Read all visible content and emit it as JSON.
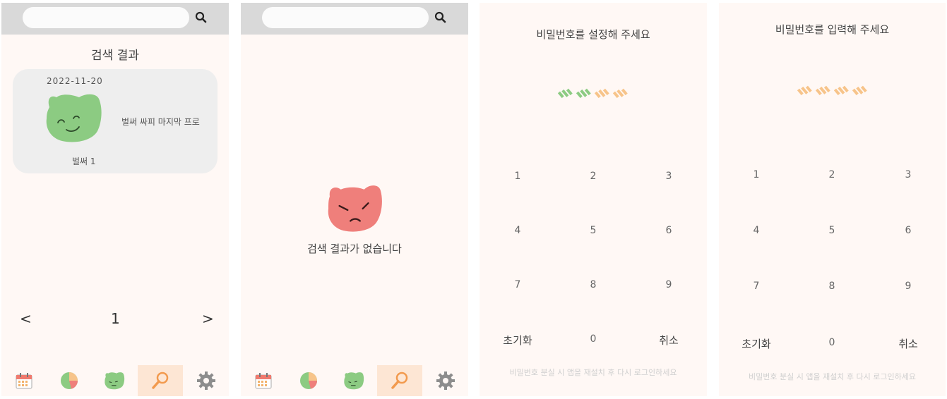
{
  "screen1": {
    "search": {
      "value": "",
      "placeholder": ""
    },
    "title": "검색 결과",
    "result": {
      "date": "2022-11-20",
      "snippet": "벌써 싸피 마지막 프로",
      "category": "벌써 1"
    },
    "pager": {
      "prev": "<",
      "page": "1",
      "next": ">"
    }
  },
  "screen2": {
    "search": {
      "value": "",
      "placeholder": ""
    },
    "empty_message": "검색 결과가 없습니다"
  },
  "screen3": {
    "title": "비밀번호를 설정해 주세요",
    "keys": [
      "1",
      "2",
      "3",
      "4",
      "5",
      "6",
      "7",
      "8",
      "9",
      "초기화",
      "0",
      "취소"
    ],
    "hint": "비밀번호 분실 시 앱을 재설치 후 다시 로그인하세요",
    "dots": [
      "filled",
      "filled",
      "empty",
      "empty"
    ]
  },
  "screen4": {
    "title": "비밀번호를 입력해 주세요",
    "keys": [
      "1",
      "2",
      "3",
      "4",
      "5",
      "6",
      "7",
      "8",
      "9",
      "초기화",
      "0",
      "취소"
    ],
    "hint": "비밀번호 분실 시 앱을 재설치 후 다시 로그인하세요",
    "dots": [
      "empty",
      "empty",
      "empty",
      "empty"
    ]
  },
  "nav_items": [
    {
      "icon": "calendar-icon"
    },
    {
      "icon": "pie-chart-icon"
    },
    {
      "icon": "mood-face-icon"
    },
    {
      "icon": "search-icon",
      "active": true
    },
    {
      "icon": "gear-icon"
    }
  ],
  "colors": {
    "panel_bg": "#fff8f5",
    "search_bar": "#d9d9d9",
    "happy_face": "#8ccb82",
    "angry_face": "#ef7f7b",
    "dot_filled": "#8ccb82",
    "dot_empty": "#f7c48a",
    "nav_active": "#fde6d4"
  }
}
